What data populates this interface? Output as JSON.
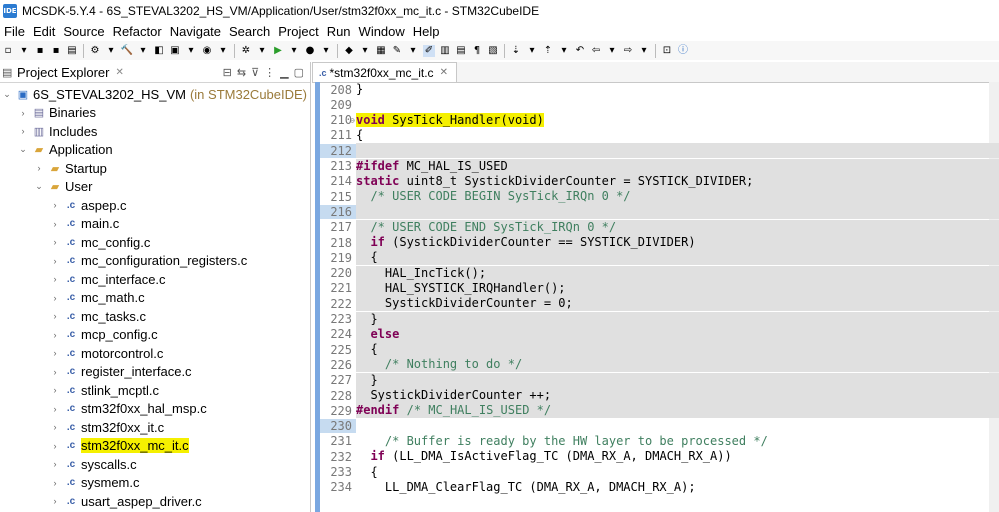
{
  "window": {
    "logo_text": "IDE",
    "title": "MCSDK-5.Y.4 - 6S_STEVAL3202_HS_VM/Application/User/stm32f0xx_mc_it.c - STM32CubeIDE"
  },
  "menu": [
    "File",
    "Edit",
    "Source",
    "Refactor",
    "Navigate",
    "Search",
    "Project",
    "Run",
    "Window",
    "Help"
  ],
  "project_explorer": {
    "title": "Project Explorer",
    "close_glyph": "✕",
    "tree": [
      {
        "label": "6S_STEVAL3202_HS_VM",
        "suffix": "(in STM32CubeIDE)",
        "level": 0,
        "icon": "project",
        "expanded": true
      },
      {
        "label": "Binaries",
        "level": 1,
        "icon": "binaries",
        "expanded": false
      },
      {
        "label": "Includes",
        "level": 1,
        "icon": "includes",
        "expanded": false
      },
      {
        "label": "Application",
        "level": 1,
        "icon": "folder",
        "expanded": true
      },
      {
        "label": "Startup",
        "level": 2,
        "icon": "folder",
        "expanded": false
      },
      {
        "label": "User",
        "level": 2,
        "icon": "folder",
        "expanded": true
      },
      {
        "label": "aspep.c",
        "level": 3,
        "icon": "c-file"
      },
      {
        "label": "main.c",
        "level": 3,
        "icon": "c-file"
      },
      {
        "label": "mc_config.c",
        "level": 3,
        "icon": "c-file"
      },
      {
        "label": "mc_configuration_registers.c",
        "level": 3,
        "icon": "c-file"
      },
      {
        "label": "mc_interface.c",
        "level": 3,
        "icon": "c-file"
      },
      {
        "label": "mc_math.c",
        "level": 3,
        "icon": "c-file"
      },
      {
        "label": "mc_tasks.c",
        "level": 3,
        "icon": "c-file"
      },
      {
        "label": "mcp_config.c",
        "level": 3,
        "icon": "c-file"
      },
      {
        "label": "motorcontrol.c",
        "level": 3,
        "icon": "c-file"
      },
      {
        "label": "register_interface.c",
        "level": 3,
        "icon": "c-file"
      },
      {
        "label": "stlink_mcptl.c",
        "level": 3,
        "icon": "c-file"
      },
      {
        "label": "stm32f0xx_hal_msp.c",
        "level": 3,
        "icon": "c-file"
      },
      {
        "label": "stm32f0xx_it.c",
        "level": 3,
        "icon": "c-file"
      },
      {
        "label": "stm32f0xx_mc_it.c",
        "level": 3,
        "icon": "c-file",
        "highlighted": true
      },
      {
        "label": "syscalls.c",
        "level": 3,
        "icon": "c-file"
      },
      {
        "label": "sysmem.c",
        "level": 3,
        "icon": "c-file"
      },
      {
        "label": "usart_aspep_driver.c",
        "level": 3,
        "icon": "c-file"
      }
    ]
  },
  "editor": {
    "tab_label": "*stm32f0xx_mc_it.c",
    "tab_close": "✕",
    "lines": [
      {
        "n": "208",
        "text": "}",
        "shaded": false
      },
      {
        "n": "209",
        "text": "",
        "shaded": false
      },
      {
        "n": "210",
        "marker": "⊖",
        "text": "void SysTick_Handler(void)",
        "shaded": false,
        "highlight": true
      },
      {
        "n": "211",
        "text": "{",
        "shaded": false
      },
      {
        "n": "212",
        "text": "",
        "shaded": true,
        "lnum_hl": true
      },
      {
        "n": "213",
        "text": "#ifdef MC_HAL_IS_USED",
        "shaded": true
      },
      {
        "n": "214",
        "text": "static uint8_t SystickDividerCounter = SYSTICK_DIVIDER;",
        "shaded": true
      },
      {
        "n": "215",
        "text": "  /* USER CODE BEGIN SysTick_IRQn 0 */",
        "shaded": true
      },
      {
        "n": "216",
        "text": "",
        "shaded": true,
        "lnum_hl": true
      },
      {
        "n": "217",
        "text": "  /* USER CODE END SysTick_IRQn 0 */",
        "shaded": true
      },
      {
        "n": "218",
        "text": "  if (SystickDividerCounter == SYSTICK_DIVIDER)",
        "shaded": true
      },
      {
        "n": "219",
        "text": "  {",
        "shaded": true
      },
      {
        "n": "220",
        "text": "    HAL_IncTick();",
        "shaded": true
      },
      {
        "n": "221",
        "text": "    HAL_SYSTICK_IRQHandler();",
        "shaded": true
      },
      {
        "n": "222",
        "text": "    SystickDividerCounter = 0;",
        "shaded": true
      },
      {
        "n": "223",
        "text": "  }",
        "shaded": true
      },
      {
        "n": "224",
        "text": "  else",
        "shaded": true
      },
      {
        "n": "225",
        "text": "  {",
        "shaded": true
      },
      {
        "n": "226",
        "text": "    /* Nothing to do */",
        "shaded": true
      },
      {
        "n": "227",
        "text": "  }",
        "shaded": true
      },
      {
        "n": "228",
        "text": "  SystickDividerCounter ++;",
        "shaded": true
      },
      {
        "n": "229",
        "text": "#endif /* MC_HAL_IS_USED */",
        "shaded": true
      },
      {
        "n": "230",
        "text": "",
        "shaded": false,
        "lnum_hl": true
      },
      {
        "n": "231",
        "text": "    /* Buffer is ready by the HW layer to be processed */",
        "shaded": false
      },
      {
        "n": "232",
        "text": "  if (LL_DMA_IsActiveFlag_TC (DMA_RX_A, DMACH_RX_A))",
        "shaded": false
      },
      {
        "n": "233",
        "text": "  {",
        "shaded": false
      },
      {
        "n": "234",
        "text": "    LL_DMA_ClearFlag_TC (DMA_RX_A, DMACH_RX_A);",
        "shaded": false
      }
    ]
  }
}
